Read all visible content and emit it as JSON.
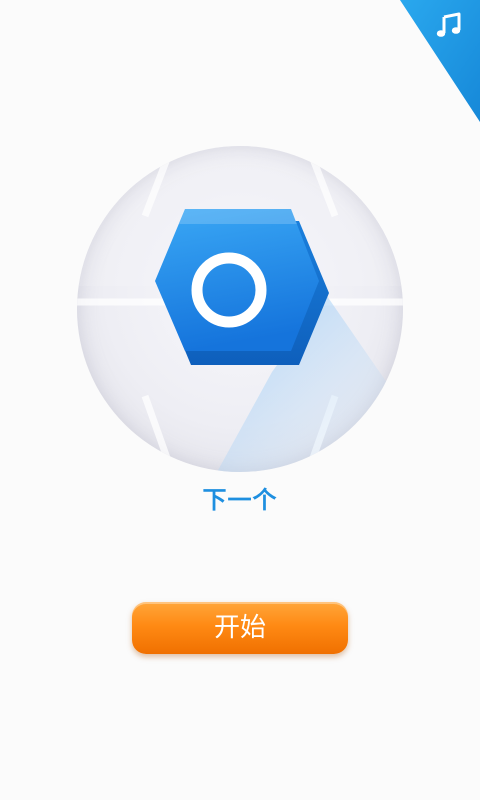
{
  "music": {
    "icon": "music-note-icon"
  },
  "hero": {
    "icon": "hexagon-circle-icon"
  },
  "next": {
    "label": "下一个"
  },
  "start": {
    "label": "开始"
  },
  "colors": {
    "accent_blue": "#1e8fe0",
    "corner_blue": "#1a9be2",
    "start_orange": "#ff8a14"
  }
}
